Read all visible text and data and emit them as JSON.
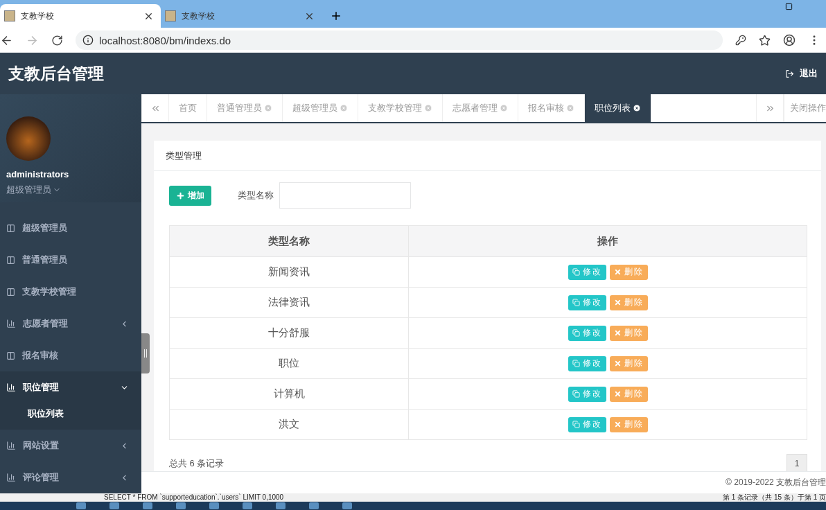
{
  "browser": {
    "tabs": [
      {
        "title": "支教学校",
        "selected": true
      },
      {
        "title": "支教学校",
        "selected": false
      }
    ],
    "url": "localhost:8080/bm/indexs.do"
  },
  "header": {
    "title": "支教后台管理",
    "logout": "退出"
  },
  "sidebar": {
    "user": {
      "name": "administrators",
      "role": "超级管理员"
    },
    "items": [
      {
        "label": "超级管理员",
        "kind": "page",
        "selected": false
      },
      {
        "label": "普通管理员",
        "kind": "page",
        "selected": false
      },
      {
        "label": "支教学校管理",
        "kind": "page",
        "selected": false
      },
      {
        "label": "志愿者管理",
        "kind": "group",
        "selected": false,
        "expanded": false
      },
      {
        "label": "报名审核",
        "kind": "page",
        "selected": false
      },
      {
        "label": "职位管理",
        "kind": "group",
        "selected": true,
        "expanded": true,
        "children": [
          {
            "label": "职位列表",
            "selected": true
          }
        ]
      },
      {
        "label": "网站设置",
        "kind": "group",
        "selected": false,
        "expanded": false
      },
      {
        "label": "评论管理",
        "kind": "group",
        "selected": false,
        "expanded": false
      }
    ]
  },
  "page_tabs": {
    "tabs": [
      {
        "label": "首页",
        "closable": false,
        "selected": false
      },
      {
        "label": "普通管理员",
        "closable": true,
        "selected": false
      },
      {
        "label": "超级管理员",
        "closable": true,
        "selected": false
      },
      {
        "label": "支教学校管理",
        "closable": true,
        "selected": false
      },
      {
        "label": "志愿者管理",
        "closable": true,
        "selected": false
      },
      {
        "label": "报名审核",
        "closable": true,
        "selected": false
      },
      {
        "label": "职位列表",
        "closable": true,
        "selected": true
      }
    ],
    "close_ops": "关闭操作"
  },
  "panel": {
    "title": "类型管理",
    "add_button": "增加",
    "filter_label": "类型名称",
    "table": {
      "columns": [
        "类型名称",
        "操作"
      ],
      "rows": [
        {
          "name": "新闻资讯",
          "actions": [
            "修改",
            "删除"
          ]
        },
        {
          "name": "法律资讯",
          "actions": [
            "修改",
            "删除"
          ]
        },
        {
          "name": "十分舒服",
          "actions": [
            "修改",
            "删除"
          ]
        },
        {
          "name": "职位",
          "actions": [
            "修改",
            "删除"
          ]
        },
        {
          "name": "计算机",
          "actions": [
            "修改",
            "删除"
          ]
        },
        {
          "name": "洪文",
          "actions": [
            "修改",
            "删除"
          ]
        }
      ]
    },
    "total": "总共 6 条记录",
    "pages": [
      {
        "label": "1",
        "selected": true
      }
    ]
  },
  "footer": "© 2019-2022 支教后台管理",
  "status_bar": {
    "query": "SELECT * FROM `supporteducation`.`users` LIMIT 0,1000",
    "info": "第 1 条记录（共 15 条）于第 1 页"
  }
}
